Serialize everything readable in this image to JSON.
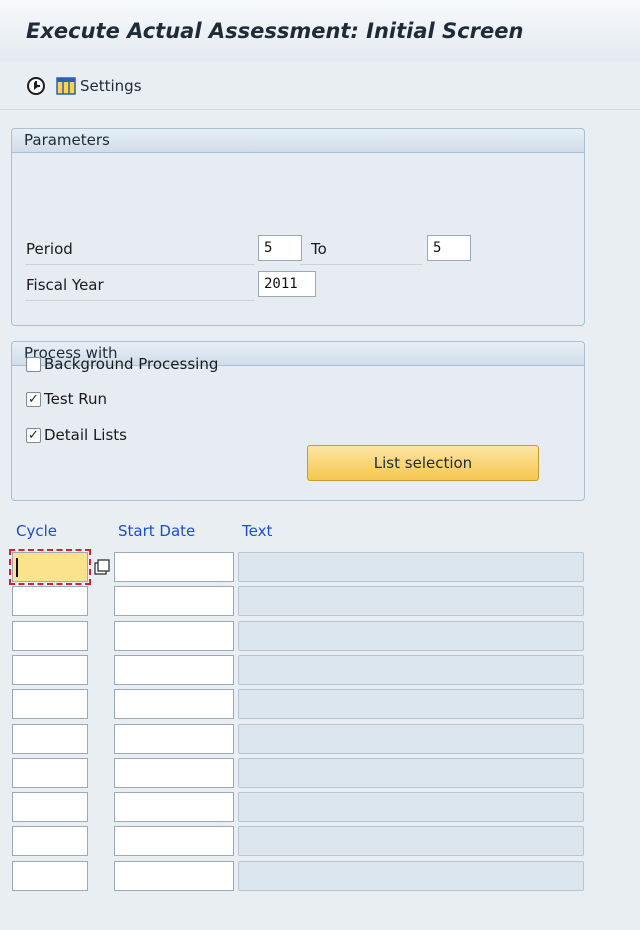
{
  "window": {
    "title": "Execute Actual Assessment: Initial Screen"
  },
  "toolbar": {
    "settings_label": "Settings"
  },
  "parameters": {
    "group_title": "Parameters",
    "period_label": "Period",
    "period_from": "5",
    "to_label": "To",
    "period_to": "5",
    "fiscal_year_label": "Fiscal Year",
    "fiscal_year": "2011"
  },
  "process": {
    "group_title": "Process with",
    "background_label": "Background Processing",
    "background_checked": false,
    "test_run_label": "Test Run",
    "test_run_checked": true,
    "detail_lists_label": "Detail Lists",
    "detail_lists_checked": true,
    "list_selection_label": "List selection",
    "check_mark": "✓"
  },
  "cycles": {
    "col_cycle": "Cycle",
    "col_start_date": "Start Date",
    "col_text": "Text",
    "rows": [
      {
        "cycle": "",
        "start_date": "",
        "text": ""
      },
      {
        "cycle": "",
        "start_date": "",
        "text": ""
      },
      {
        "cycle": "",
        "start_date": "",
        "text": ""
      },
      {
        "cycle": "",
        "start_date": "",
        "text": ""
      },
      {
        "cycle": "",
        "start_date": "",
        "text": ""
      },
      {
        "cycle": "",
        "start_date": "",
        "text": ""
      },
      {
        "cycle": "",
        "start_date": "",
        "text": ""
      },
      {
        "cycle": "",
        "start_date": "",
        "text": ""
      },
      {
        "cycle": "",
        "start_date": "",
        "text": ""
      },
      {
        "cycle": "",
        "start_date": "",
        "text": ""
      }
    ]
  },
  "icons": {
    "execute": "execute-clock-icon",
    "settings": "layout-settings-icon",
    "value_help": "value-help-icon"
  },
  "colors": {
    "link_blue": "#1d4dcf",
    "button_yellow": "#f6c64f",
    "focus_yellow": "#fae38c",
    "focus_outline": "#d2232a"
  }
}
